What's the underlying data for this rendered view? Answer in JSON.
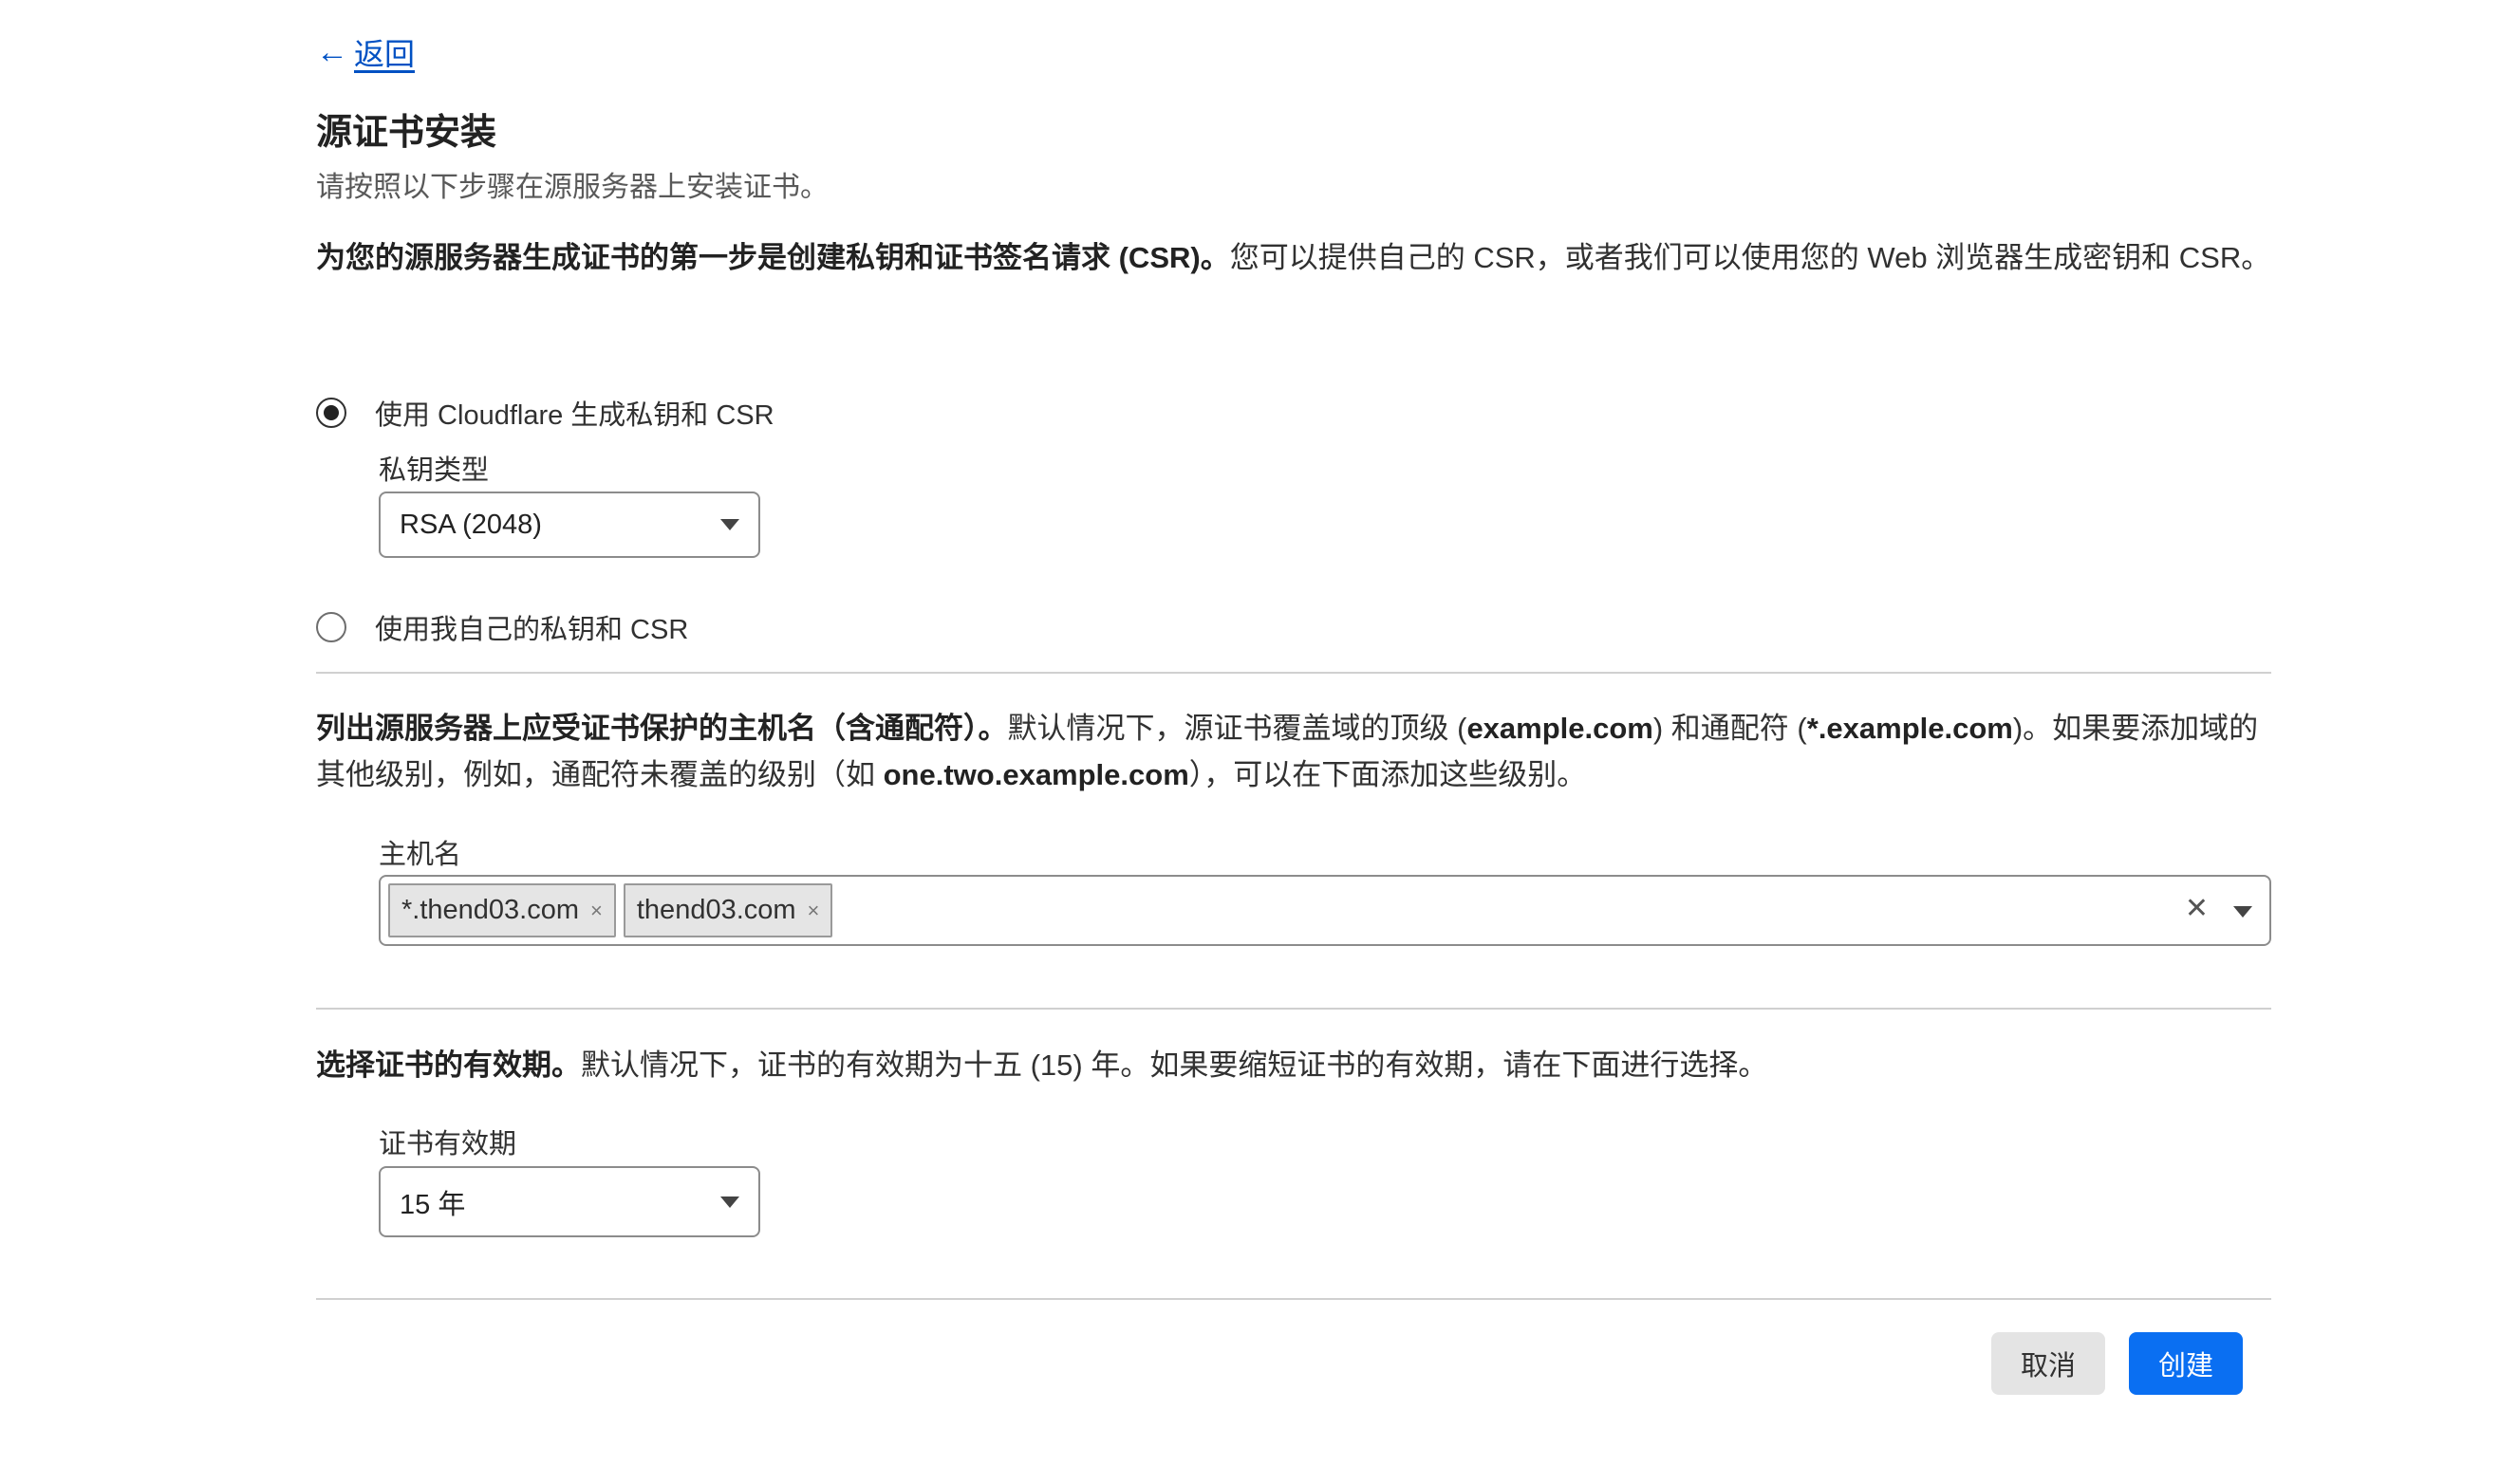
{
  "nav": {
    "back_arrow": "←",
    "back_label": "返回"
  },
  "header": {
    "title": "源证书安装",
    "subtitle": "请按照以下步骤在源服务器上安装证书。"
  },
  "section_key": {
    "intro_bold": "为您的源服务器生成证书的第一步是创建私钥和证书签名请求 (CSR)。",
    "intro_rest": "您可以提供自己的 CSR，或者我们可以使用您的 Web 浏览器生成密钥和 CSR。",
    "option_cloudflare": "使用 Cloudflare 生成私钥和 CSR",
    "option_own": "使用我自己的私钥和 CSR",
    "key_type_label": "私钥类型",
    "key_type_value": "RSA (2048)",
    "selected_option": "cloudflare"
  },
  "section_hosts": {
    "p_bold1": "列出源服务器上应受证书保护的主机名（含通配符）。",
    "p_text1": "默认情况下，源证书覆盖域的顶级 (",
    "p_bold2": "example.com",
    "p_text2": ") 和通配符 (",
    "p_bold3": "*.example.com",
    "p_text3": ")。如果要添加域的其他级别，例如，通配符未覆盖的级别（如 ",
    "p_bold4": "one.two.example.com",
    "p_text4": "），可以在下面添加这些级别。",
    "hostname_label": "主机名",
    "hostnames": [
      "*.thend03.com",
      "thend03.com"
    ],
    "chip_remove_glyph": "×",
    "clear_glyph": "✕"
  },
  "section_validity": {
    "p_bold": "选择证书的有效期。",
    "p_text": "默认情况下，证书的有效期为十五 (15) 年。如果要缩短证书的有效期，请在下面进行选择。",
    "validity_label": "证书有效期",
    "validity_value": "15 年"
  },
  "footer": {
    "cancel_label": "取消",
    "create_label": "创建"
  },
  "colors": {
    "link": "#0051c3",
    "primary": "#0a6ff2",
    "cancel_bg": "#e4e4e4"
  }
}
